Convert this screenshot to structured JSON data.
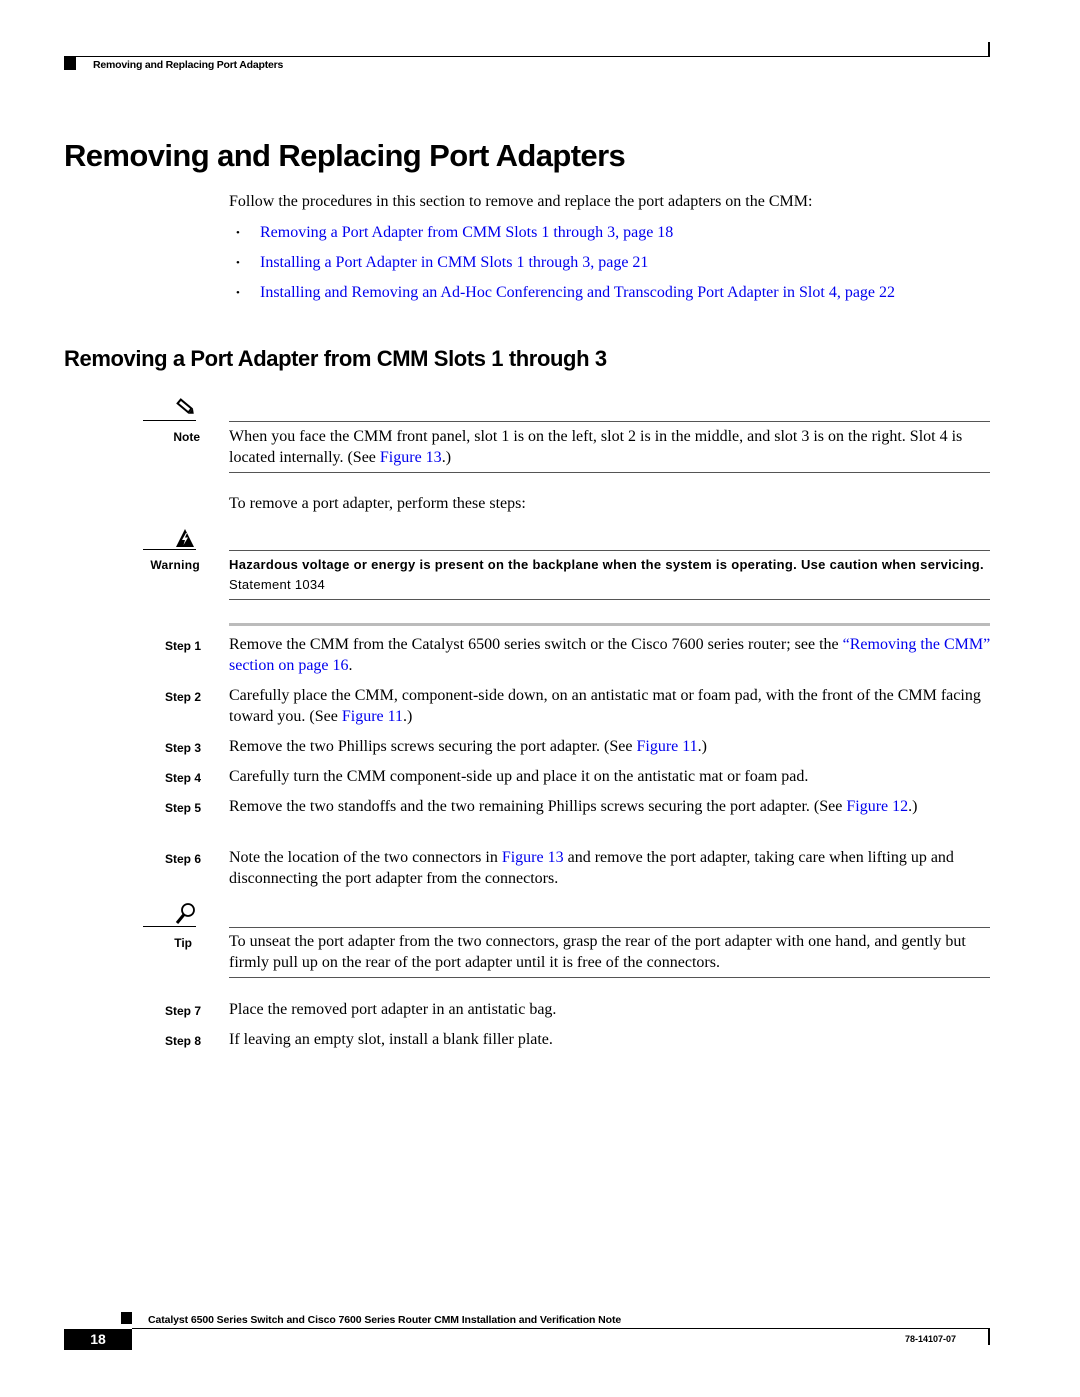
{
  "header": {
    "running_title": "Removing and Replacing Port Adapters"
  },
  "title": "Removing and Replacing Port Adapters",
  "intro": "Follow the procedures in this section to remove and replace the port adapters on the CMM:",
  "toc_links": [
    {
      "label": "Removing a Port Adapter from CMM Slots 1 through 3, page 18"
    },
    {
      "label": "Installing a Port Adapter in CMM Slots 1 through 3, page 21"
    },
    {
      "label": "Installing and Removing an Ad-Hoc Conferencing and Transcoding Port Adapter in Slot 4, page 22"
    }
  ],
  "section_title": "Removing a Port Adapter from CMM Slots 1 through 3",
  "note": {
    "label": "Note",
    "icon": "pencil-icon",
    "text_before": "When you face the CMM front panel, slot 1 is on the left, slot 2 is in the middle, and slot 3 is on the right. Slot 4 is located internally. (See ",
    "link": "Figure 13",
    "text_after": ".)"
  },
  "steps_intro": "To remove a port adapter, perform these steps:",
  "warning": {
    "label": "Warning",
    "icon": "high-voltage-icon",
    "bold_text": "Hazardous voltage or energy is present on the backplane when the system is operating. Use caution when servicing.",
    "statement": " Statement 1034"
  },
  "steps": [
    {
      "label": "Step 1",
      "text_before": "Remove the CMM from the Catalyst 6500 series switch or the Cisco 7600 series router; see the ",
      "link": "“Removing the CMM” section on page 16",
      "text_after": "."
    },
    {
      "label": "Step 2",
      "text_before": "Carefully place the CMM, component-side down, on an antistatic mat or foam pad, with the front of the CMM facing toward you. (See ",
      "link": "Figure 11",
      "text_after": ".)"
    },
    {
      "label": "Step 3",
      "text_before": "Remove the two Phillips screws securing the port adapter. (See ",
      "link": "Figure 11",
      "text_after": ".)"
    },
    {
      "label": "Step 4",
      "text_before": "Carefully turn the CMM component-side up and place it on the antistatic mat or foam pad.",
      "link": "",
      "text_after": ""
    },
    {
      "label": "Step 5",
      "text_before": "Remove the two standoffs and the two remaining Phillips screws securing the port adapter. (See ",
      "link": "Figure 12",
      "text_after": ".)"
    },
    {
      "label": "Step 6",
      "text_before": "Note the location of the two connectors in ",
      "link": "Figure 13",
      "text_after": " and remove the port adapter, taking care when lifting up and disconnecting the port adapter from the connectors."
    },
    {
      "label": "Step 7",
      "text_before": "Place the removed port adapter in an antistatic bag.",
      "link": "",
      "text_after": ""
    },
    {
      "label": "Step 8",
      "text_before": "If leaving an empty slot, install a blank filler plate.",
      "link": "",
      "text_after": ""
    }
  ],
  "tip": {
    "label": "Tip",
    "icon": "magnifier-icon",
    "text": "To unseat the port adapter from the two connectors, grasp the rear of the port adapter with one hand, and gently but firmly pull up on the rear of the port adapter until it is free of the connectors."
  },
  "footer": {
    "doc_title": "Catalyst 6500 Series Switch and Cisco 7600 Series Router CMM Installation and Verification Note",
    "page_number": "18",
    "doc_number": "78-14107-07"
  },
  "colors": {
    "link": "#0000ee",
    "text": "#000000"
  }
}
